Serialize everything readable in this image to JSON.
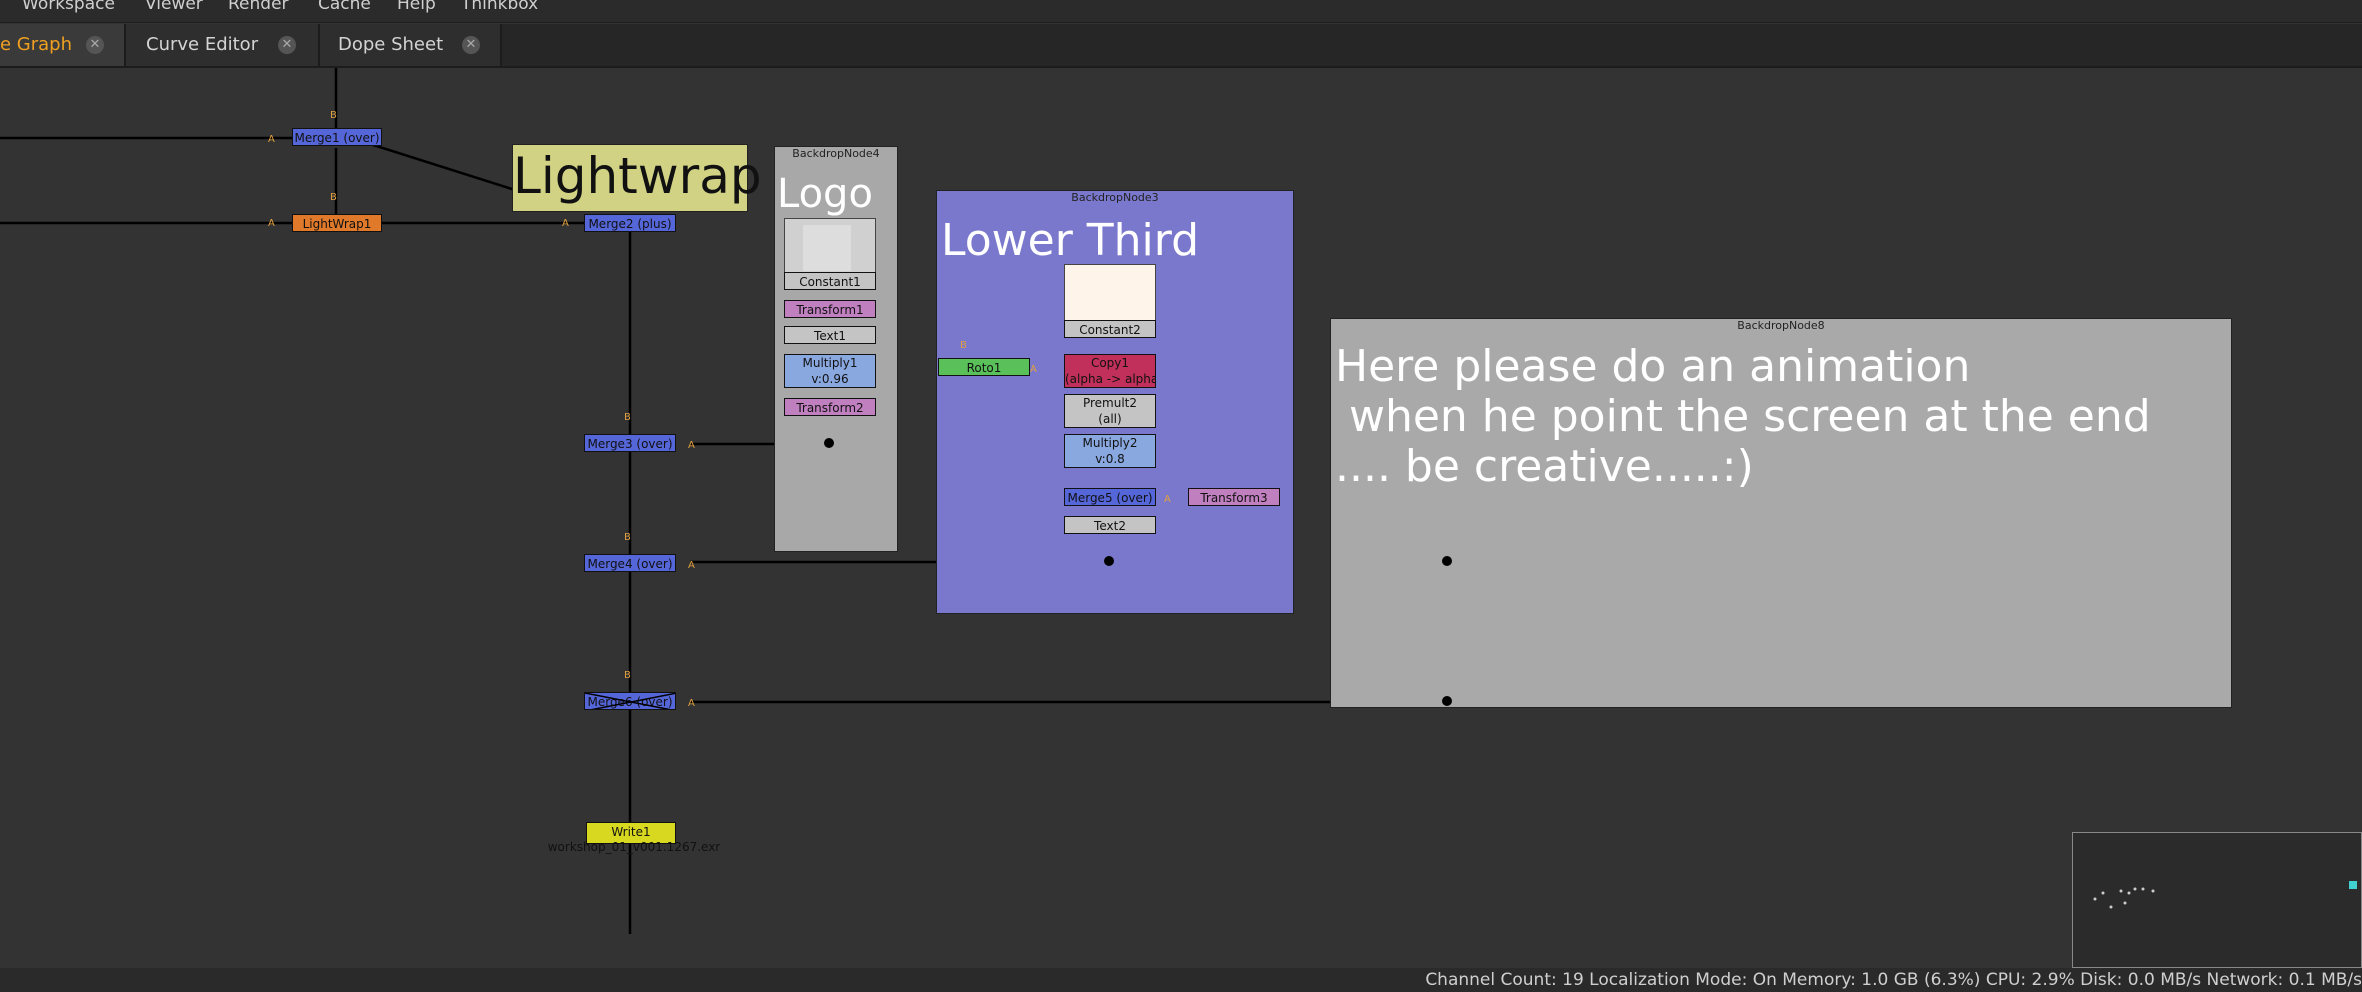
{
  "menu": [
    "Workspace",
    "Viewer",
    "Render",
    "Cache",
    "Help",
    "Thinkbox"
  ],
  "tabs": [
    {
      "label": "e Graph",
      "active": true
    },
    {
      "label": "Curve Editor",
      "active": false
    },
    {
      "label": "Dope Sheet",
      "active": false
    }
  ],
  "tab_close_glyph": "✕",
  "nodes": {
    "merge_top": "Merge1 (over)",
    "lightwrap": "LightWrap1",
    "merge2": "Merge2 (plus)",
    "constant1": "Constant1",
    "transform1": "Transform1",
    "text1": "Text1",
    "multiply1": "Multiply1",
    "multiply1_sub": "v:0.96",
    "transform2": "Transform2",
    "merge3": "Merge3 (over)",
    "roto1": "Roto1",
    "constant2": "Constant2",
    "copy1": "Copy1",
    "copy1_sub": "(alpha -> alpha)",
    "premult2": "Premult2",
    "premult2_sub": "(all)",
    "multiply2": "Multiply2",
    "multiply2_sub": "v:0.8",
    "merge5": "Merge5 (over)",
    "transform3": "Transform3",
    "text2": "Text2",
    "merge4": "Merge4 (over)",
    "merge6": "Merge6 (over)",
    "write1": "Write1",
    "write1_file": "workshop_01_v001.1267.exr"
  },
  "pins": {
    "a": "A",
    "b": "B"
  },
  "backdrops": {
    "lightwrap_label": "Lightwrap",
    "logo_title": "BackdropNode4",
    "logo_label": "Logo",
    "lower_title": "BackdropNode3",
    "lower_label": "Lower Third",
    "note_title": "BackdropNode8",
    "note_line1": "Here please do an animation",
    "note_line2": " when he point the screen at the end",
    "note_line3": ".... be creative.....:)"
  },
  "colors": {
    "lightwrap_bd": "#d2d284",
    "logo_bd": "#a8a8a8",
    "lower_bd": "#7a78cc",
    "note_bd": "#a9a9a9",
    "accent_tab": "#f0a020"
  },
  "status": "Channel Count: 19  Localization Mode: On  Memory: 1.0 GB (6.3%)  CPU: 2.9%  Disk: 0.0 MB/s  Network: 0.1 MB/s"
}
